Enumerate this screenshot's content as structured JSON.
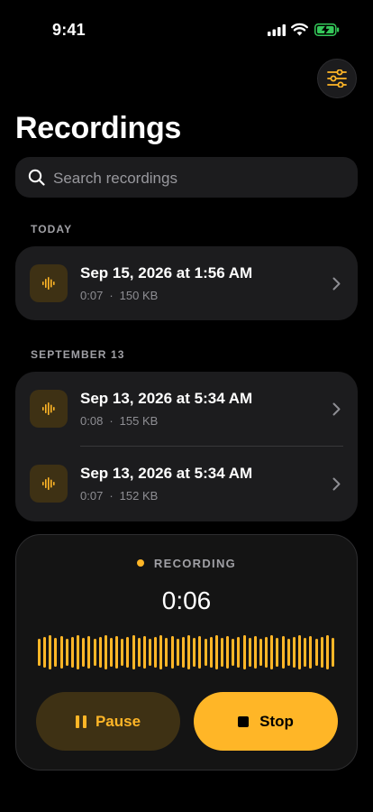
{
  "status_bar": {
    "time": "9:41",
    "icons": [
      "signal-icon",
      "wifi-icon",
      "battery-charging-icon"
    ]
  },
  "header": {
    "title": "Recordings",
    "filter_icon": "sliders-icon"
  },
  "search": {
    "placeholder": "Search recordings",
    "value": ""
  },
  "sections": [
    {
      "header": "TODAY",
      "items": [
        {
          "title": "Sep 15, 2026 at 1:56 AM",
          "duration": "0:07",
          "size": "150 KB"
        }
      ]
    },
    {
      "header": "SEPTEMBER 13",
      "items": [
        {
          "title": "Sep 13, 2026 at 5:34 AM",
          "duration": "0:08",
          "size": "155 KB"
        },
        {
          "title": "Sep 13, 2026 at 5:34 AM",
          "duration": "0:07",
          "size": "152 KB"
        }
      ]
    }
  ],
  "recorder": {
    "status": "RECORDING",
    "timer": "0:06",
    "pause_label": "Pause",
    "stop_label": "Stop"
  },
  "meta_separator": "·",
  "colors": {
    "accent": "#ffb627",
    "accent_dim": "#3e3114",
    "card": "#1c1c1e",
    "background": "#000000"
  }
}
